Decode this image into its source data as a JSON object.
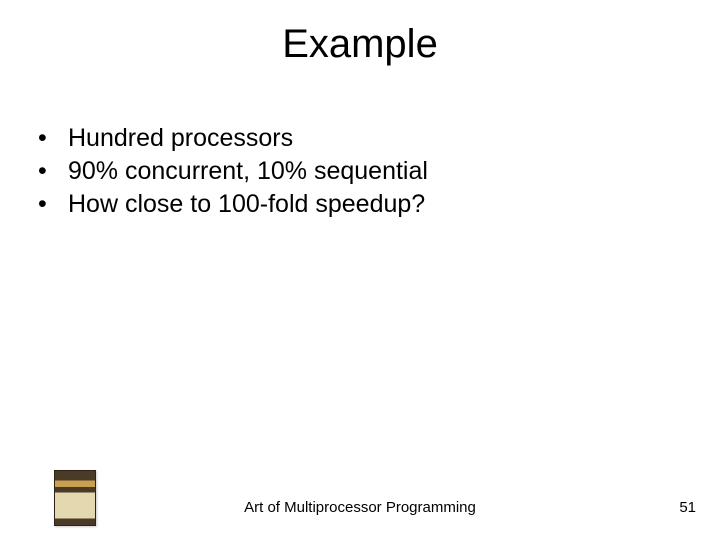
{
  "title": "Example",
  "bullets": [
    "Hundred processors",
    "90% concurrent, 10% sequential",
    "How close to 100-fold speedup?"
  ],
  "footer": "Art of Multiprocessor Programming",
  "page_number": "51"
}
